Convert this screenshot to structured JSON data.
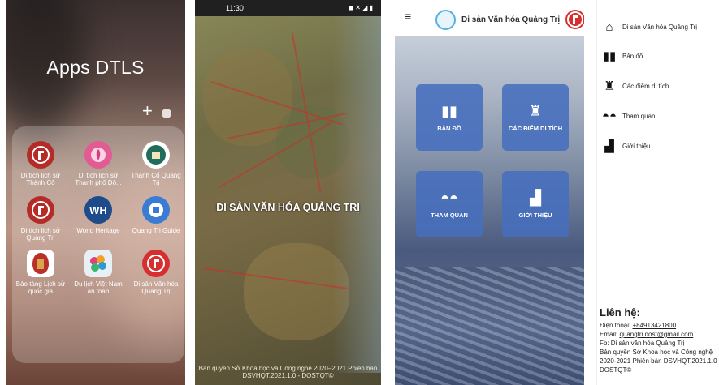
{
  "panel1": {
    "folder_title": "Apps DTLS",
    "add_symbol": "+",
    "apps": [
      {
        "label": "Di tích lịch sử Thành Cổ",
        "icon": "red-seal-icon",
        "color": "#b52b27"
      },
      {
        "label": "Di tích lịch sử Thành phố Đô...",
        "icon": "pink-flower-icon",
        "color": "#e25b93"
      },
      {
        "label": "Thành Cổ Quảng Trị",
        "icon": "teal-emblem-icon",
        "color": "#1f6d5a"
      },
      {
        "label": "Di tích lịch sử Quảng Trị",
        "icon": "red-seal-icon",
        "color": "#b52b27"
      },
      {
        "label": "World Heritage",
        "icon": "world-heritage-icon",
        "color": "#1e4c8a",
        "glyph": "WH"
      },
      {
        "label": "Quang Tri Guide",
        "icon": "blue-guide-icon",
        "color": "#3a7bd5"
      },
      {
        "label": "Bảo tàng Lịch sử quốc gia",
        "icon": "museum-icon",
        "color": "#b8302a"
      },
      {
        "label": "Du lịch Việt Nam an toàn",
        "icon": "vietnam-tourism-icon",
        "color": "#e8f0f6"
      },
      {
        "label": "Di sản Văn hóa Quảng Trị",
        "icon": "red-seal-icon",
        "color": "#d62f2f"
      }
    ]
  },
  "panel2": {
    "status_time": "11:30",
    "map_title": "DI SẢN VĂN HÓA QUẢNG TRỊ",
    "copyright": "Bản quyền Sở Khoa học và Công nghệ 2020–2021 Phiên bản DSVHQT.2021.1.0 - DOSTQT©"
  },
  "panel3": {
    "app_title": "Di sản Văn hóa Quảng Trị",
    "tiles": [
      {
        "label": "BẢN ĐỒ",
        "icon": "map-icon",
        "glyph": "▮▮"
      },
      {
        "label": "CÁC ĐIỂM DI TÍCH",
        "icon": "castle-icon",
        "glyph": "♜"
      },
      {
        "label": "THAM QUAN",
        "icon": "binoculars-icon",
        "glyph": "◓◓"
      },
      {
        "label": "GIỚI THIỆU",
        "icon": "sticky-note-icon",
        "glyph": "▟"
      }
    ]
  },
  "panel4": {
    "menu": [
      {
        "label": "Di sản Văn hóa Quảng Trị",
        "icon": "home-icon",
        "glyph": "⌂"
      },
      {
        "label": "Bản đồ",
        "icon": "map-icon",
        "glyph": "▮▮"
      },
      {
        "label": "Các điểm di tích",
        "icon": "castle-icon",
        "glyph": "♜"
      },
      {
        "label": "Tham quan",
        "icon": "binoculars-icon",
        "glyph": "◓◓"
      },
      {
        "label": "Giới thiệu",
        "icon": "sticky-note-icon",
        "glyph": "▟"
      }
    ],
    "contact_title": "Liên hệ:",
    "phone_label": "Điện thoại: ",
    "phone": "+84913421800",
    "email_label": "Email: ",
    "email": "quangtri.dost@gmail.com",
    "fb": "Fb: Di sản văn hóa Quảng Trị",
    "copyright_1": "Bản quyền Sở Khoa học và Công nghệ",
    "copyright_2": "2020-2021 Phiên bản DSVHQT.2021.1.0 -",
    "copyright_3": "DOSTQT©"
  }
}
